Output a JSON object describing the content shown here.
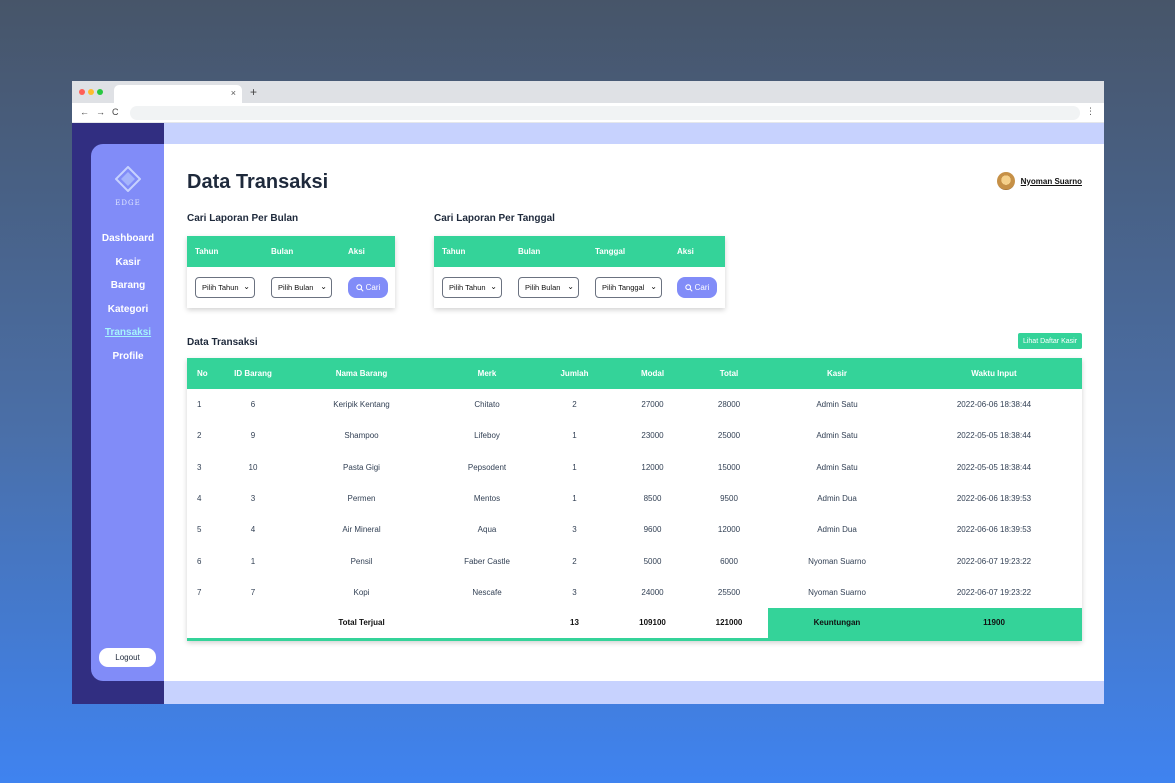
{
  "colors": {
    "accent": "#34d399",
    "sidebar": "#818cf8",
    "sidebar_dark": "#312e81",
    "app_bg": "#c7d2fe",
    "button": "#818cf8"
  },
  "browser": {
    "tab_close": "×",
    "new_tab": "+",
    "nav": [
      "←",
      "→",
      "C"
    ],
    "menu": "⋮"
  },
  "sidebar": {
    "logo_text": "EDGE",
    "items": [
      {
        "label": "Dashboard"
      },
      {
        "label": "Kasir"
      },
      {
        "label": "Barang"
      },
      {
        "label": "Kategori"
      },
      {
        "label": "Transaksi",
        "active": true
      },
      {
        "label": "Profile"
      }
    ],
    "logout": "Logout"
  },
  "header": {
    "title": "Data Transaksi",
    "user": "Nyoman Suarno"
  },
  "search_month": {
    "title": "Cari Laporan Per Bulan",
    "headers": [
      "Tahun",
      "Bulan",
      "Aksi"
    ],
    "year": "Pilih Tahun",
    "month": "Pilih Bulan",
    "button": "Cari"
  },
  "search_date": {
    "title": "Cari Laporan Per Tanggal",
    "headers": [
      "Tahun",
      "Bulan",
      "Tanggal",
      "Aksi"
    ],
    "year": "Pilih Tahun",
    "month": "Pilih Bulan",
    "day": "Pilih Tanggal",
    "button": "Cari"
  },
  "transactions": {
    "title": "Data Transaksi",
    "kasir_button": "Lihat Daftar Kasir",
    "columns": [
      "No",
      "ID Barang",
      "Nama Barang",
      "Merk",
      "Jumlah",
      "Modal",
      "Total",
      "Kasir",
      "Waktu Input"
    ],
    "rows": [
      [
        "1",
        "6",
        "Keripik Kentang",
        "Chitato",
        "2",
        "27000",
        "28000",
        "Admin Satu",
        "2022-06-06 18:38:44"
      ],
      [
        "2",
        "9",
        "Shampoo",
        "Lifeboy",
        "1",
        "23000",
        "25000",
        "Admin Satu",
        "2022-05-05 18:38:44"
      ],
      [
        "3",
        "10",
        "Pasta Gigi",
        "Pepsodent",
        "1",
        "12000",
        "15000",
        "Admin Satu",
        "2022-05-05 18:38:44"
      ],
      [
        "4",
        "3",
        "Permen",
        "Mentos",
        "1",
        "8500",
        "9500",
        "Admin Dua",
        "2022-06-06 18:39:53"
      ],
      [
        "5",
        "4",
        "Air Mineral",
        "Aqua",
        "3",
        "9600",
        "12000",
        "Admin Dua",
        "2022-06-06 18:39:53"
      ],
      [
        "6",
        "1",
        "Pensil",
        "Faber Castle",
        "2",
        "5000",
        "6000",
        "Nyoman Suarno",
        "2022-06-07 19:23:22"
      ],
      [
        "7",
        "7",
        "Kopi",
        "Nescafe",
        "3",
        "24000",
        "25500",
        "Nyoman Suarno",
        "2022-06-07 19:23:22"
      ]
    ],
    "footer": {
      "label": "Total Terjual",
      "jumlah": "13",
      "modal": "109100",
      "total": "121000",
      "profit_label": "Keuntungan",
      "profit": "11900"
    }
  }
}
